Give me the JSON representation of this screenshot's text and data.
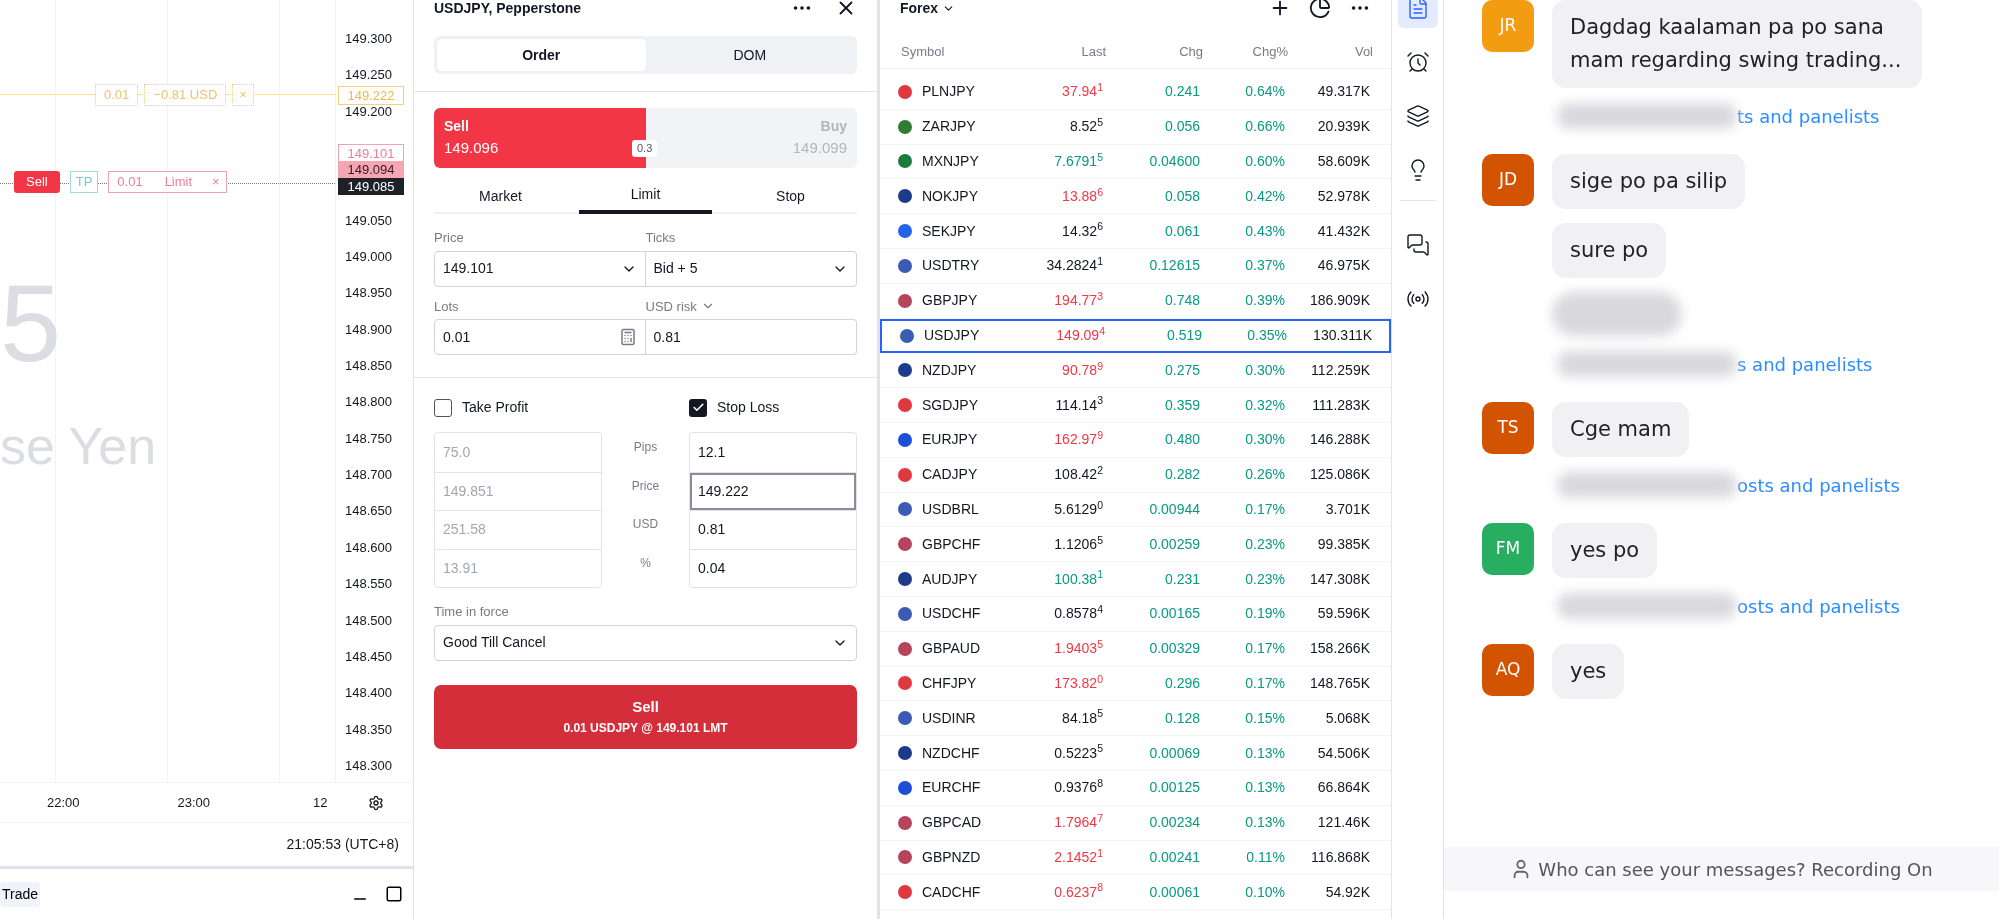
{
  "chart": {
    "price_axis": [
      "149.300",
      "149.250",
      "149.200",
      "149.050",
      "149.000",
      "148.950",
      "148.900",
      "148.850",
      "148.800",
      "148.750",
      "148.700",
      "148.650",
      "148.600",
      "148.550",
      "148.500",
      "148.450",
      "148.400",
      "148.350",
      "148.300"
    ],
    "watermark": [
      "5",
      "se Yen"
    ],
    "order_line": {
      "lots": "0.01",
      "pnl": "−0.81 USD",
      "close": "×"
    },
    "position_line": {
      "side": "Sell",
      "tp": "TP",
      "lots": "0.01",
      "type": "Limit",
      "close": "×"
    },
    "price_tags": [
      {
        "kind": "stop",
        "value": "149.222"
      },
      {
        "kind": "limit",
        "value": "149.101"
      },
      {
        "kind": "bid",
        "value": "149.094"
      },
      {
        "kind": "last",
        "value": "149.085"
      }
    ],
    "time_axis": [
      "22:00",
      "23:00",
      "12"
    ],
    "timestamp": "21:05:53 (UTC+8)",
    "bottom_tab": "Trade"
  },
  "order": {
    "title": "USDJPY, Pepperstone",
    "tabs": [
      {
        "label": "Order",
        "selected": true
      },
      {
        "label": "DOM",
        "selected": false
      }
    ],
    "sell": {
      "label": "Sell",
      "price": "149.096"
    },
    "spread": "0.3",
    "buy": {
      "label": "Buy",
      "price": "149.099"
    },
    "order_types": [
      {
        "label": "Market",
        "selected": false
      },
      {
        "label": "Limit",
        "selected": true
      },
      {
        "label": "Stop",
        "selected": false
      }
    ],
    "price": {
      "label": "Price",
      "value": "149.101"
    },
    "ticks": {
      "label": "Ticks",
      "value": "Bid + 5"
    },
    "lots": {
      "label": "Lots",
      "value": "0.01"
    },
    "risk": {
      "label": "USD risk",
      "value": "0.81"
    },
    "take_profit": {
      "label": "Take Profit",
      "checked": false,
      "fields": [
        {
          "value": "75.0",
          "focused": false
        },
        {
          "value": "149.851",
          "focused": false
        },
        {
          "value": "251.58",
          "focused": false
        },
        {
          "value": "13.91",
          "focused": false
        }
      ]
    },
    "stop_loss": {
      "label": "Stop Loss",
      "checked": true,
      "fields": [
        {
          "value": "12.1",
          "focused": false
        },
        {
          "value": "149.222",
          "focused": true
        },
        {
          "value": "0.81",
          "focused": false
        },
        {
          "value": "0.04",
          "focused": false
        }
      ]
    },
    "row_labels": [
      "Pips",
      "Price",
      "USD",
      "%"
    ],
    "time_in_force": {
      "label": "Time in force",
      "value": "Good Till Cancel"
    },
    "submit": {
      "label": "Sell",
      "detail": "0.01 USDJPY @ 149.101 LMT"
    }
  },
  "forex": {
    "title": "Forex",
    "columns": [
      "Symbol",
      "Last",
      "Chg",
      "Chg%",
      "Vol"
    ],
    "rows": [
      {
        "symbol": "PLNJPY",
        "last": "37.94$^{1}$",
        "kind": "down",
        "chg": "0.241",
        "chg_pct": "0.64%",
        "vol": "49.317K",
        "color": "#e0383e",
        "selected": false
      },
      {
        "symbol": "ZARJPY",
        "last": "8.52$^{5}$",
        "kind": "flat",
        "chg": "0.056",
        "chg_pct": "0.66%",
        "vol": "20.939K",
        "color": "#2e7d32",
        "selected": false
      },
      {
        "symbol": "MXNJPY",
        "last": "7.6791$^{5}$",
        "kind": "up",
        "chg": "0.04600",
        "chg_pct": "0.60%",
        "vol": "58.609K",
        "color": "#1b7a3e",
        "selected": false
      },
      {
        "symbol": "NOKJPY",
        "last": "13.88$^{6}$",
        "kind": "down",
        "chg": "0.058",
        "chg_pct": "0.42%",
        "vol": "52.978K",
        "color": "#1e3a8a",
        "selected": false
      },
      {
        "symbol": "SEKJPY",
        "last": "14.32$^{6}$",
        "kind": "flat",
        "chg": "0.061",
        "chg_pct": "0.43%",
        "vol": "41.432K",
        "color": "#2563eb",
        "selected": false
      },
      {
        "symbol": "USDTRY",
        "last": "34.2824$^{1}$",
        "kind": "flat",
        "chg": "0.12615",
        "chg_pct": "0.37%",
        "vol": "46.975K",
        "color": "#3b5bb5",
        "selected": false
      },
      {
        "symbol": "GBPJPY",
        "last": "194.77$^{3}$",
        "kind": "down",
        "chg": "0.748",
        "chg_pct": "0.39%",
        "vol": "186.909K",
        "color": "#b4455a",
        "selected": false
      },
      {
        "symbol": "USDJPY",
        "last": "149.09$^{4}$",
        "kind": "down",
        "chg": "0.519",
        "chg_pct": "0.35%",
        "vol": "130.311K",
        "color": "#3b5bb5",
        "selected": true
      },
      {
        "symbol": "NZDJPY",
        "last": "90.78$^{9}$",
        "kind": "down",
        "chg": "0.275",
        "chg_pct": "0.30%",
        "vol": "112.259K",
        "color": "#1e3a8a",
        "selected": false
      },
      {
        "symbol": "SGDJPY",
        "last": "114.14$^{3}$",
        "kind": "flat",
        "chg": "0.359",
        "chg_pct": "0.32%",
        "vol": "111.283K",
        "color": "#e0383e",
        "selected": false
      },
      {
        "symbol": "EURJPY",
        "last": "162.97$^{9}$",
        "kind": "down",
        "chg": "0.480",
        "chg_pct": "0.30%",
        "vol": "146.288K",
        "color": "#1d4ed8",
        "selected": false
      },
      {
        "symbol": "CADJPY",
        "last": "108.42$^{2}$",
        "kind": "flat",
        "chg": "0.282",
        "chg_pct": "0.26%",
        "vol": "125.086K",
        "color": "#e0383e",
        "selected": false
      },
      {
        "symbol": "USDBRL",
        "last": "5.6129$^{0}$",
        "kind": "flat",
        "chg": "0.00944",
        "chg_pct": "0.17%",
        "vol": "3.701K",
        "color": "#3b5bb5",
        "selected": false
      },
      {
        "symbol": "GBPCHF",
        "last": "1.1206$^{5}$",
        "kind": "flat",
        "chg": "0.00259",
        "chg_pct": "0.23%",
        "vol": "99.385K",
        "color": "#b4455a",
        "selected": false
      },
      {
        "symbol": "AUDJPY",
        "last": "100.38$^{1}$",
        "kind": "up",
        "chg": "0.231",
        "chg_pct": "0.23%",
        "vol": "147.308K",
        "color": "#1e3a8a",
        "selected": false
      },
      {
        "symbol": "USDCHF",
        "last": "0.8578$^{4}$",
        "kind": "flat",
        "chg": "0.00165",
        "chg_pct": "0.19%",
        "vol": "59.596K",
        "color": "#3b5bb5",
        "selected": false
      },
      {
        "symbol": "GBPAUD",
        "last": "1.9403$^{5}$",
        "kind": "down",
        "chg": "0.00329",
        "chg_pct": "0.17%",
        "vol": "158.266K",
        "color": "#b4455a",
        "selected": false
      },
      {
        "symbol": "CHFJPY",
        "last": "173.82$^{0}$",
        "kind": "down",
        "chg": "0.296",
        "chg_pct": "0.17%",
        "vol": "148.765K",
        "color": "#e0383e",
        "selected": false
      },
      {
        "symbol": "USDINR",
        "last": "84.18$^{5}$",
        "kind": "flat",
        "chg": "0.128",
        "chg_pct": "0.15%",
        "vol": "5.068K",
        "color": "#3b5bb5",
        "selected": false
      },
      {
        "symbol": "NZDCHF",
        "last": "0.5223$^{5}$",
        "kind": "flat",
        "chg": "0.00069",
        "chg_pct": "0.13%",
        "vol": "54.506K",
        "color": "#1e3a8a",
        "selected": false
      },
      {
        "symbol": "EURCHF",
        "last": "0.9376$^{8}$",
        "kind": "flat",
        "chg": "0.00125",
        "chg_pct": "0.13%",
        "vol": "66.864K",
        "color": "#1d4ed8",
        "selected": false
      },
      {
        "symbol": "GBPCAD",
        "last": "1.7964$^{7}$",
        "kind": "down",
        "chg": "0.00234",
        "chg_pct": "0.13%",
        "vol": "121.46K",
        "color": "#b4455a",
        "selected": false
      },
      {
        "symbol": "GBPNZD",
        "last": "2.1452$^{1}$",
        "kind": "down",
        "chg": "0.00241",
        "chg_pct": "0.11%",
        "vol": "116.868K",
        "color": "#b4455a",
        "selected": false
      },
      {
        "symbol": "CADCHF",
        "last": "0.6237$^{8}$",
        "kind": "down",
        "chg": "0.00061",
        "chg_pct": "0.10%",
        "vol": "54.92K",
        "color": "#e0383e",
        "selected": false
      }
    ]
  },
  "toolbar": [
    {
      "kind": "list",
      "selected": true
    },
    {
      "kind": "alarm",
      "selected": false
    },
    {
      "kind": "layers",
      "selected": false
    },
    {
      "kind": "idea",
      "selected": false
    },
    {
      "kind": "chat",
      "selected": false
    },
    {
      "kind": "broadcast",
      "selected": false
    }
  ],
  "chat": {
    "messages": [
      {
        "kind": "message",
        "initials": "JR",
        "color": "#f39c12",
        "text": "Dagdag kaalaman pa po sana mam regarding swing trading..."
      },
      {
        "kind": "notice",
        "text": "ts and panelists"
      },
      {
        "kind": "message",
        "initials": "JD",
        "color": "#d35400",
        "text": "sige po pa silip"
      },
      {
        "kind": "message",
        "text": "sure po"
      },
      {
        "kind": "blurred"
      },
      {
        "kind": "notice",
        "text": "s and panelists"
      },
      {
        "kind": "message",
        "initials": "TS",
        "color": "#d35400",
        "text": "Cge mam"
      },
      {
        "kind": "notice",
        "text": "osts and panelists"
      },
      {
        "kind": "message",
        "initials": "FM",
        "color": "#27ae60",
        "text": "yes po"
      },
      {
        "kind": "notice",
        "text": "osts and panelists"
      },
      {
        "kind": "message",
        "initials": "AQ",
        "color": "#d35400",
        "text": "yes"
      }
    ],
    "footer": "Who can see your messages? Recording On"
  }
}
